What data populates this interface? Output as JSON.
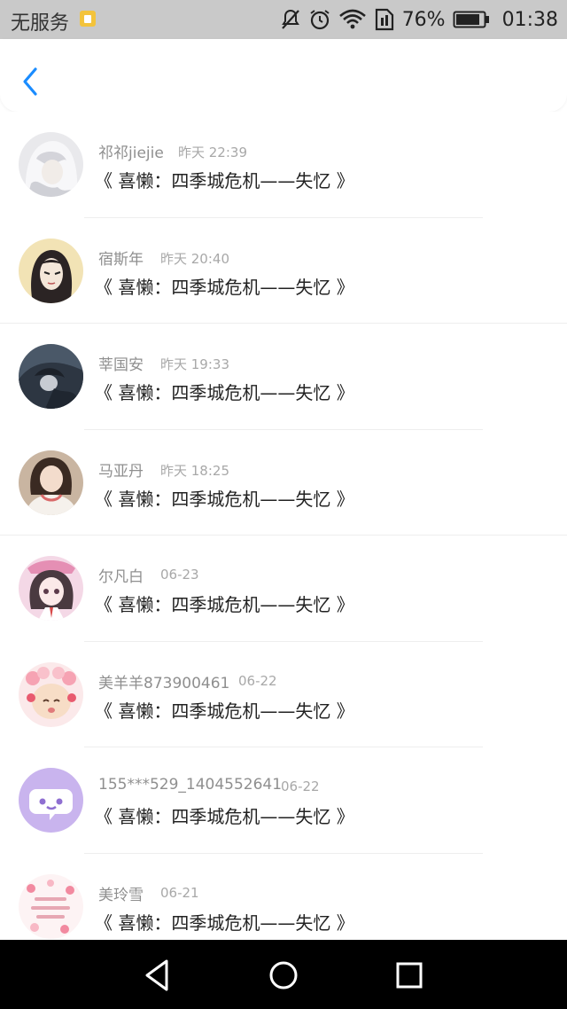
{
  "status_bar": {
    "carrier": "无服务",
    "battery_percent": "76%",
    "time": "01:38"
  },
  "header": {
    "back_icon": "chevron-left-icon"
  },
  "colors": {
    "accent": "#1a8cff",
    "status_bar_bg": "#c9c9c9",
    "nav_bar_bg": "#000000"
  },
  "list": {
    "items": [
      {
        "user": "祁祁jiejie",
        "time": "昨天 22:39",
        "title": "《 喜懒：四季城危机——失忆 》",
        "avatar": "white-haired-anime-avatar"
      },
      {
        "user": "宿斯年",
        "time": "昨天 20:40",
        "title": "《 喜懒：四季城危机——失忆 》",
        "avatar": "dark-haired-cartoon-avatar"
      },
      {
        "user": "莘国安",
        "time": "昨天 19:33",
        "title": "《 喜懒：四季城危机——失忆 》",
        "avatar": "dark-anime-avatar"
      },
      {
        "user": "马亚丹",
        "time": "昨天 18:25",
        "title": "《 喜懒：四季城危机——失忆 》",
        "avatar": "girl-photo-avatar"
      },
      {
        "user": "尔凡白",
        "time": "06-23",
        "title": "《 喜懒：四季城危机——失忆 》",
        "avatar": "pink-anime-girl-avatar"
      },
      {
        "user": "美羊羊873900461",
        "time": "06-22",
        "title": "《 喜懒：四季城危机——失忆 》",
        "avatar": "pretty-goat-avatar"
      },
      {
        "user": "155***529_1404552641",
        "time": "06-22",
        "title": "《 喜懒：四季城危机——失忆 》",
        "avatar": "purple-chat-bubble-avatar"
      },
      {
        "user": "美玲雪",
        "time": "06-21",
        "title": "《 喜懒：四季城危机——失忆 》",
        "avatar": "pink-doodle-avatar"
      }
    ]
  }
}
